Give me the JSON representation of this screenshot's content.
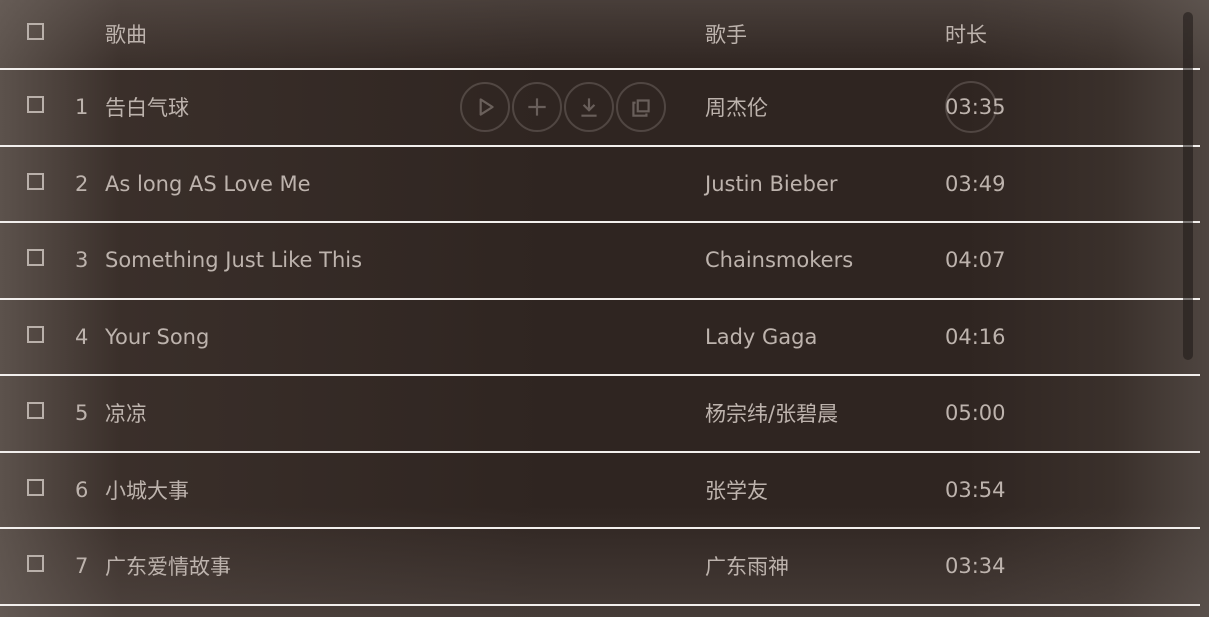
{
  "header": {
    "title_col": "歌曲",
    "artist_col": "歌手",
    "duration_col": "时长"
  },
  "songs": [
    {
      "index": "1",
      "title": "告白气球",
      "artist": "周杰伦",
      "duration": "03:35"
    },
    {
      "index": "2",
      "title": "As long AS Love Me",
      "artist": "Justin Bieber",
      "duration": "03:49"
    },
    {
      "index": "3",
      "title": "Something Just Like This",
      "artist": "Chainsmokers",
      "duration": "04:07"
    },
    {
      "index": "4",
      "title": "Your Song",
      "artist": "Lady Gaga",
      "duration": "04:16"
    },
    {
      "index": "5",
      "title": "凉凉",
      "artist": "杨宗纬/张碧晨",
      "duration": "05:00"
    },
    {
      "index": "6",
      "title": "小城大事",
      "artist": "张学友",
      "duration": "03:54"
    },
    {
      "index": "7",
      "title": "广东爱情故事",
      "artist": "广东雨神",
      "duration": "03:34"
    }
  ],
  "row_actions": [
    "play-icon",
    "add-icon",
    "download-icon",
    "share-icon"
  ],
  "colors": {
    "text": "#bdb3ad",
    "divider": "#f2efed",
    "background": "#2f2521"
  }
}
